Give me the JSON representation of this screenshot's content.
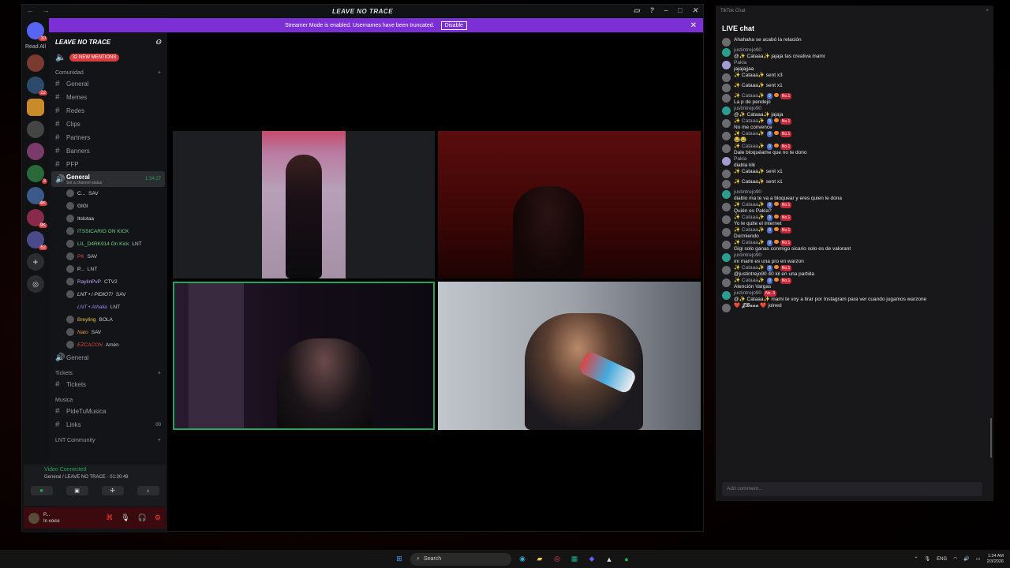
{
  "discord": {
    "window_title": "LEAVE NO TRACE",
    "rail_label": "Read All",
    "streamer_banner": {
      "text": "Streamer Mode is enabled. Usernames have been truncated.",
      "action": "Disable"
    },
    "server_name": "LEAVE NO TRACE",
    "mentions": "32 NEW MENTIONS",
    "categories": [
      {
        "name": "Comunidad",
        "channels": [
          "General",
          "Memes",
          "Redes",
          "Clips",
          "Partners",
          "Banners",
          "PFP"
        ]
      },
      {
        "name": "Tickets",
        "channels": [
          "Tickets"
        ]
      },
      {
        "name": "Musica",
        "channels": [
          "PideTuMusica",
          "Links"
        ]
      },
      {
        "name": "LNT Community",
        "channels": []
      }
    ],
    "active_voice": {
      "name": "General",
      "sub": "Set a channel status",
      "time": "1:34:27"
    },
    "voice_users": [
      {
        "name": "C...",
        "tag": "SAV"
      },
      {
        "name": "GIGI",
        "tag": ""
      },
      {
        "name": "Itslotaa",
        "tag": ""
      },
      {
        "name": "ITSSICARIO ON KICK",
        "tag": ""
      },
      {
        "name": "LIL_D4RK914 On Kick",
        "tag": "LNT"
      },
      {
        "name": "PK",
        "tag": "SAV"
      },
      {
        "name": "P...",
        "tag": "LNT"
      },
      {
        "name": "RaylinPvP",
        "tag": "CTV2"
      },
      {
        "name": "LNT • i PIDIOT!",
        "tag": "SAV"
      },
      {
        "name": "LNT • Athalia",
        "tag": "LNT"
      },
      {
        "name": "Breyling",
        "tag": "BOLA"
      },
      {
        "name": "Nato",
        "tag": "SAV"
      },
      {
        "name": "EZCACON",
        "tag": "Amén"
      }
    ],
    "second_voice": "General",
    "links_count": "00",
    "voice_panel": {
      "status": "Video Connected",
      "where": "General / LEAVE NO TRACE",
      "time": "01:30:49"
    },
    "user_panel": {
      "name": "P...",
      "status": "In voice"
    }
  },
  "tiktok": {
    "window_label": "TikTok Chat",
    "heading": "LIVE chat",
    "messages": [
      {
        "user": "",
        "text": "Ahahaha se acabó la relación",
        "av": "grey"
      },
      {
        "user": "justintrejo90",
        "text": "@✨ Cataaa✨ jajaja tas creativa mami",
        "av": "teal"
      },
      {
        "user": "Pakla",
        "text": "jajajajjaa",
        "av": "lav"
      },
      {
        "inline": "✨ Cataaa✨  sent  x3",
        "av": "grey"
      },
      {
        "inline": "✨ Cataaa✨  sent  x1",
        "av": "grey"
      },
      {
        "user": "✨ Cataaa✨",
        "badges": true,
        "text": "La p de pendejo",
        "av": "grey"
      },
      {
        "user": "justintrejo90",
        "text": "@✨ Cataaa✨ jajaja",
        "av": "teal"
      },
      {
        "user": "✨ Cataaa✨",
        "badges": true,
        "text": "No me convence",
        "av": "grey"
      },
      {
        "user": "✨ Cataaa✨",
        "badges": true,
        "text": "😂😂",
        "av": "grey"
      },
      {
        "user": "✨ Cataaa✨",
        "badges": true,
        "text": "Dale bloquéame que no te dono",
        "av": "grey"
      },
      {
        "user": "Pakla",
        "text": "diabla klk",
        "av": "lav"
      },
      {
        "inline": "✨ Cataaa✨  sent  x1",
        "av": "grey"
      },
      {
        "inline": "✨ Cataaa✨  sent  x1",
        "av": "grey"
      },
      {
        "user": "justintrejo90",
        "text": "diablo ma te va a bloquear y eres quien le dona",
        "av": "teal"
      },
      {
        "user": "✨ Cataaa✨",
        "badges": true,
        "text": "Quién es Pakla?",
        "av": "grey"
      },
      {
        "user": "✨ Cataaa✨",
        "badges": true,
        "text": "Yo le quite el internet",
        "av": "grey"
      },
      {
        "user": "✨ Cataaa✨",
        "badges": true,
        "text": "Durmiendo",
        "av": "grey"
      },
      {
        "user": "✨ Cataaa✨",
        "badges": true,
        "text": "Gigi solo ganas conmigo sicario solo es de valorant",
        "av": "grey"
      },
      {
        "user": "justintrejo90",
        "text": "mi mami es una pro en warzon",
        "av": "teal"
      },
      {
        "user": "✨ Cataaa✨",
        "badges": true,
        "text": "@justintrejo90 40 kil en una partida",
        "av": "grey"
      },
      {
        "user": "✨ Cataaa✨",
        "badges": true,
        "text": "Atención Vargas",
        "av": "grey"
      },
      {
        "user": "justintrejo90",
        "badge3": "No. 3",
        "text": "@✨ Cataaa✨  mami te voy a tirar por Instagram para ver cuando jugamos warzone",
        "av": "teal"
      },
      {
        "inline": "❤️ 𝓙𝓑𝓪𝓪𝓪 ❤️  joined",
        "av": "grey"
      }
    ],
    "badge_level": "9",
    "badge_rank": "No.1",
    "input_placeholder": "Add comment..."
  },
  "taskbar": {
    "search": "Search",
    "lang": "ENG",
    "time": "1:34 AM",
    "date": "2/3/2026"
  }
}
